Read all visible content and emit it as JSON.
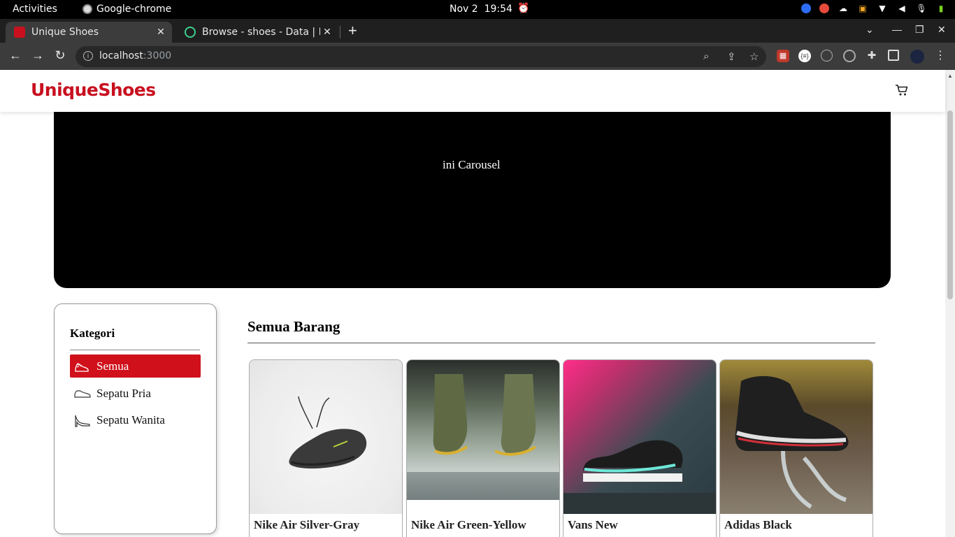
{
  "system_bar": {
    "activities": "Activities",
    "app_name": "Google-chrome",
    "date": "Nov 2",
    "time": "19:54"
  },
  "browser": {
    "tabs": [
      {
        "title": "Unique Shoes",
        "active": true
      },
      {
        "title": "Browse - shoes - Data | Ha",
        "active": false
      }
    ],
    "url_host": "localhost",
    "url_port": ":3000"
  },
  "site": {
    "brand": "UniqueShoes",
    "carousel_text": "ini Carousel",
    "sidebar": {
      "title": "Kategori",
      "items": [
        {
          "label": "Semua",
          "icon": "sneaker-icon",
          "active": true
        },
        {
          "label": "Sepatu Pria",
          "icon": "mens-shoe-icon",
          "active": false
        },
        {
          "label": "Sepatu Wanita",
          "icon": "high-heel-icon",
          "active": false
        }
      ]
    },
    "section_title": "Semua Barang",
    "products": [
      {
        "name": "Nike Air Silver-Gray"
      },
      {
        "name": "Nike Air Green-Yellow"
      },
      {
        "name": "Vans New"
      },
      {
        "name": "Adidas Black"
      }
    ]
  },
  "colors": {
    "brand_red": "#c8101f",
    "active_category": "#d0101a",
    "carousel_bg": "#000000"
  }
}
